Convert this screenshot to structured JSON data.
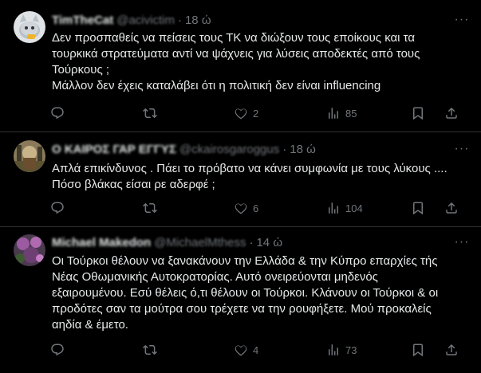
{
  "tweets": [
    {
      "name": "TimTheCat",
      "handle": "@acivictim",
      "time": "18 ώ",
      "lines": [
        "Δεν προσπαθείς να πείσεις τους ΤΚ να διώξουν τους εποίκους και τα",
        "τουρκικά στρατεύματα αντί να ψάχνεις για λύσεις αποδεκτές από τους",
        "Τούρκους ;",
        "Μάλλον δεν έχεις καταλάβει ότι η πολιτική δεν είναι influencing"
      ],
      "replies": "",
      "retweets": "",
      "likes": "2",
      "views": "85"
    },
    {
      "name": "Ο ΚΑΙΡΟΣ ΓΑΡ ΕΓΓΥΣ",
      "handle": "@ckairosgaroggus",
      "time": "18 ώ",
      "lines": [
        "Απλά επικίνδυνος . Πάει το πρόβατο να κάνει συμφωνία με τους λύκους ....",
        "Πόσο βλάκας είσαι ρε αδερφέ ;"
      ],
      "replies": "",
      "retweets": "",
      "likes": "6",
      "views": "104"
    },
    {
      "name": "Michael Makedon",
      "handle": "@MichaelMthess",
      "time": "14 ώ",
      "lines": [
        "Οι Τούρκοι θέλουν να ξανακάνουν την Ελλάδα & την Κύπρο επαρχίες τής",
        "Νέας Οθωμανικής Αυτοκρατορίας. Αυτό ονειρεύονται μηδενός",
        "εξαιρουμένου. Εσύ θέλεις ό,τι θέλουν οι Τούρκοι. Κλάνουν οι Τούρκοι & οι",
        "προδότες σαν τα μούτρα σου τρέχετε να την ρουφήξετε. Μού προκαλείς",
        "αηδία & έμετο."
      ],
      "replies": "",
      "retweets": "",
      "likes": "4",
      "views": "73"
    }
  ],
  "icons": {
    "reply": "reply-icon",
    "retweet": "retweet-icon",
    "like": "heart-icon",
    "views": "views-icon",
    "bookmark": "bookmark-icon",
    "share": "share-icon",
    "more": "more-icon"
  },
  "colors": {
    "background": "#000000",
    "text": "#e7e9ea",
    "muted": "#71767b",
    "divider": "#2f3336"
  }
}
